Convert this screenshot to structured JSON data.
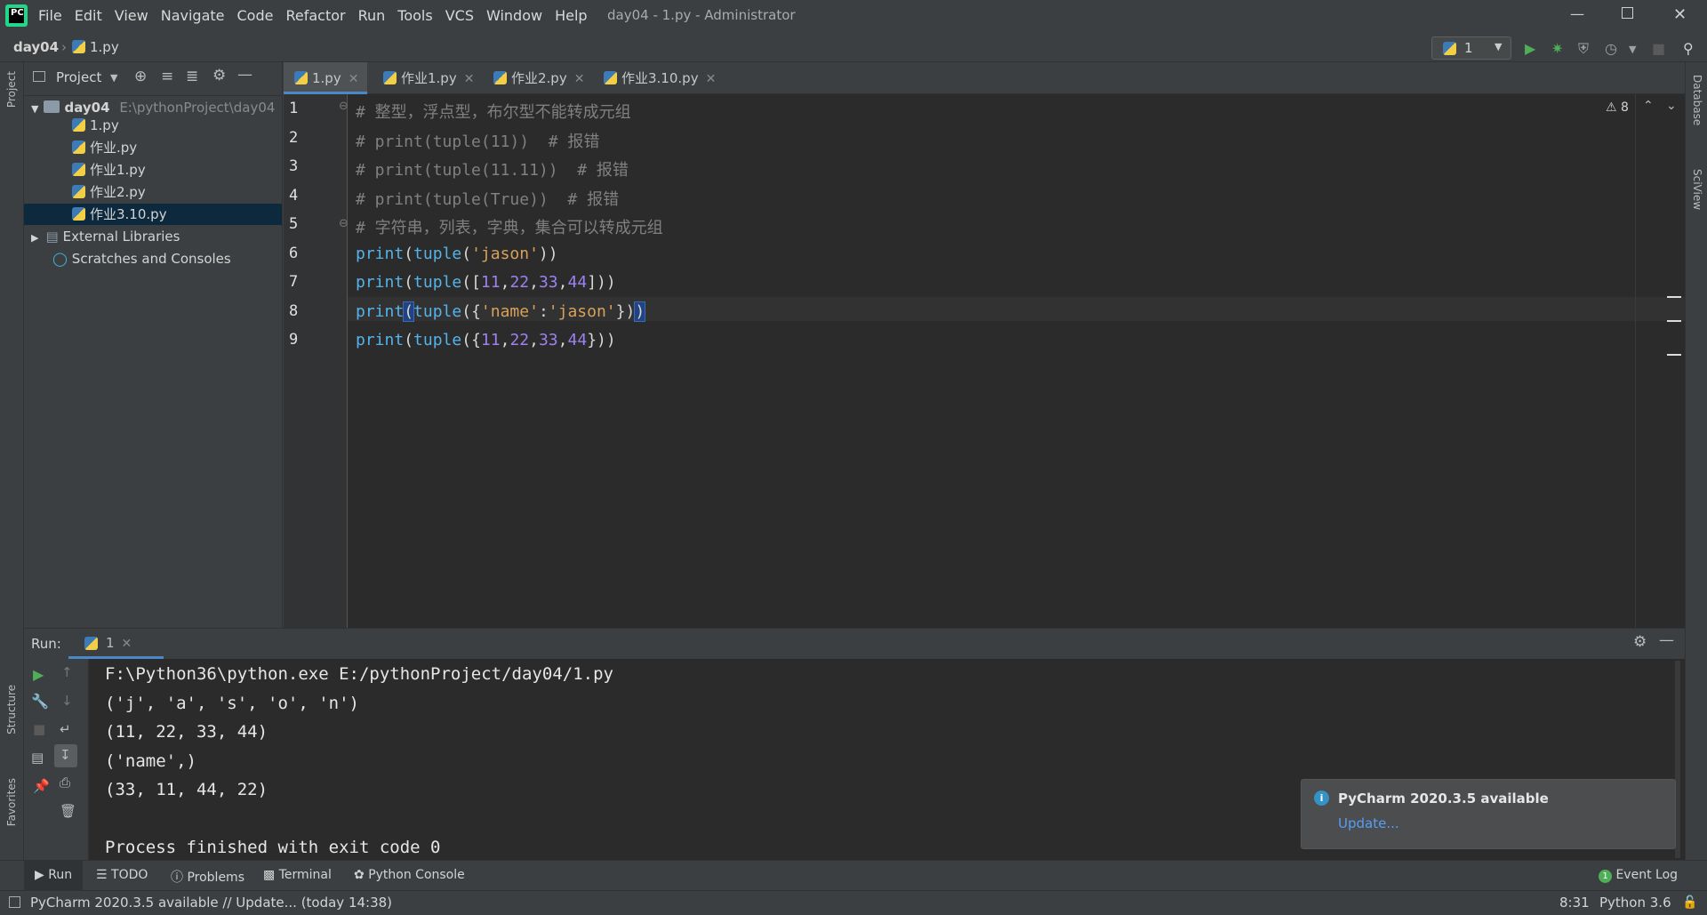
{
  "window": {
    "title": "day04 - 1.py - Administrator"
  },
  "menu": [
    "File",
    "Edit",
    "View",
    "Navigate",
    "Code",
    "Refactor",
    "Run",
    "Tools",
    "VCS",
    "Window",
    "Help"
  ],
  "breadcrumb": {
    "project": "day04",
    "file": "1.py"
  },
  "run_config": {
    "label": "1"
  },
  "project_panel": {
    "title": "Project",
    "root": {
      "name": "day04",
      "path": "E:\\pythonProject\\day04"
    },
    "files": [
      "1.py",
      "作业.py",
      "作业1.py",
      "作业2.py",
      "作业3.10.py"
    ],
    "selected": "作业3.10.py",
    "external": "External Libraries",
    "scratches": "Scratches and Consoles"
  },
  "tabs": [
    {
      "label": "1.py",
      "active": true
    },
    {
      "label": "作业1.py"
    },
    {
      "label": "作业2.py"
    },
    {
      "label": "作业3.10.py"
    }
  ],
  "editor": {
    "warnings": "8",
    "lines": [
      {
        "n": "1",
        "text": "# 整型，浮点型，布尔型不能转成元组"
      },
      {
        "n": "2",
        "text": "# print(tuple(11))  # 报错"
      },
      {
        "n": "3",
        "text": "# print(tuple(11.11))  # 报错"
      },
      {
        "n": "4",
        "text": "# print(tuple(True))  # 报错"
      },
      {
        "n": "5",
        "text": "# 字符串，列表，字典，集合可以转成元组"
      },
      {
        "n": "6",
        "text": "print(tuple('jason'))"
      },
      {
        "n": "7",
        "text": "print(tuple([11,22,33,44]))"
      },
      {
        "n": "8",
        "text": "print(tuple({'name':'jason'}))"
      },
      {
        "n": "9",
        "text": "print(tuple({11,22,33,44}))"
      }
    ]
  },
  "run_panel": {
    "label": "Run:",
    "tab": "1",
    "output": [
      "F:\\Python36\\python.exe E:/pythonProject/day04/1.py",
      "('j', 'a', 's', 'o', 'n')",
      "(11, 22, 33, 44)",
      "('name',)",
      "(33, 11, 44, 22)",
      "",
      "Process finished with exit code 0"
    ]
  },
  "notification": {
    "title": "PyCharm 2020.3.5 available",
    "link": "Update..."
  },
  "bottom_tools": [
    "Run",
    "TODO",
    "Problems",
    "Terminal",
    "Python Console"
  ],
  "event_log": "Event Log",
  "side_labels": {
    "project": "Project",
    "structure": "Structure",
    "favorites": "Favorites",
    "database": "Database",
    "sciview": "SciView"
  },
  "status": {
    "message": "PyCharm 2020.3.5 available // Update... (today 14:38)",
    "position": "8:31",
    "interpreter": "Python 3.6"
  },
  "colors": {
    "accent": "#4a88c7",
    "run_green": "#4fae58",
    "link": "#589df6"
  }
}
